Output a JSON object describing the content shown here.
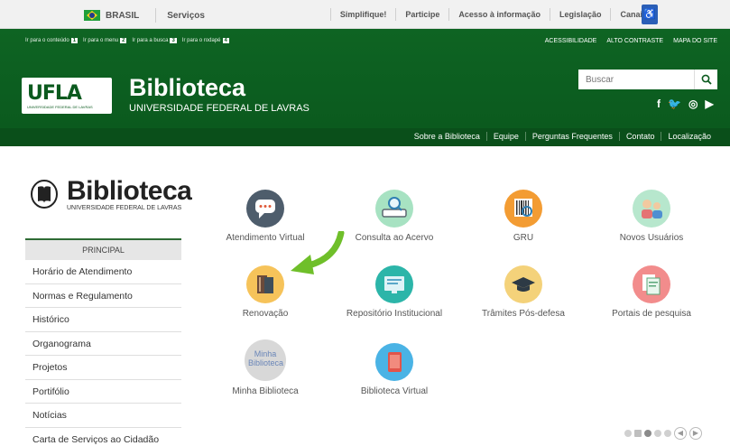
{
  "govbar": {
    "country": "BRASIL",
    "services": "Serviços",
    "links": [
      "Simplifique!",
      "Participe",
      "Acesso à informação",
      "Legislação",
      "Canais"
    ]
  },
  "header": {
    "skip_links": [
      {
        "label": "Ir para o conteúdo",
        "key": "1"
      },
      {
        "label": "Ir para o menu",
        "key": "2"
      },
      {
        "label": "Ir para a busca",
        "key": "3"
      },
      {
        "label": "Ir para o rodapé",
        "key": "4"
      }
    ],
    "top_links": [
      "ACESSIBILIDADE",
      "ALTO CONTRASTE",
      "MAPA DO SITE"
    ],
    "logo_mark": "UFLA",
    "logo_sub": "UNIVERSIDADE FEDERAL DE LAVRAS",
    "title": "Biblioteca",
    "subtitle": "UNIVERSIDADE FEDERAL DE LAVRAS",
    "search_placeholder": "Buscar",
    "social": [
      "f",
      "🐦",
      "◎",
      "▶"
    ]
  },
  "subnav": [
    "Sobre a Biblioteca",
    "Equipe",
    "Perguntas Frequentes",
    "Contato",
    "Localização"
  ],
  "sidebar": {
    "logo_title": "Biblioteca",
    "logo_sub": "UNIVERSIDADE FEDERAL DE LAVRAS",
    "menu_title": "PRINCIPAL",
    "items": [
      "Horário de Atendimento",
      "Normas e Regulamento",
      "Histórico",
      "Organograma",
      "Projetos",
      "Portifólio",
      "Notícias",
      "Carta de Serviços ao Cidadão"
    ]
  },
  "tiles": [
    {
      "label": "Atendimento Virtual",
      "color": "#4e5d6c"
    },
    {
      "label": "Consulta ao Acervo",
      "color": "#a7e2c2"
    },
    {
      "label": "GRU",
      "color": "#f39c33"
    },
    {
      "label": "Novos Usuários",
      "color": "#b7e7cd"
    },
    {
      "label": "Renovação",
      "color": "#f6c35a"
    },
    {
      "label": "Repositório Institucional",
      "color": "#2cb5a9"
    },
    {
      "label": "Trâmites Pós-defesa",
      "color": "#f4d27a"
    },
    {
      "label": "Portais de pesquisa",
      "color": "#f28c8c"
    },
    {
      "label": "Minha Biblioteca",
      "color": "#d8d8d8",
      "inner_text": "Minha Biblioteca"
    },
    {
      "label": "Biblioteca Virtual",
      "color": "#4ab3e5"
    }
  ]
}
